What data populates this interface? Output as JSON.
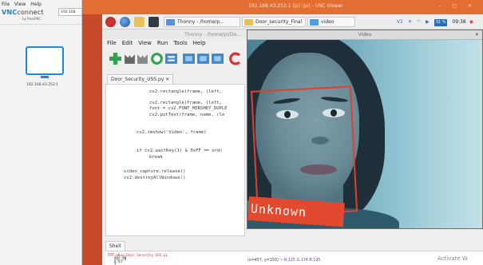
{
  "vnc_app": {
    "menu": [
      "File",
      "View",
      "Help"
    ],
    "logo_bold": "VNC",
    "logo_light": "connect",
    "logo_sub": "by RealVNC",
    "address_value": "192.168",
    "host_label": "192.168.43.252:1"
  },
  "viewer": {
    "title": "192.168.43.252:1 (pi) (pi) - VNC Viewer",
    "window_buttons": "– □ ✕"
  },
  "taskbar": {
    "apps": [
      {
        "label": "Thonny - /home/p..."
      },
      {
        "label": "Door_security_Final"
      },
      {
        "label": "video"
      }
    ],
    "battery": "31 %",
    "clock": "09:38"
  },
  "thonny": {
    "title": "Thonny - /home/pi/Do...",
    "menu": [
      "File",
      "Edit",
      "View",
      "Run",
      "Tools",
      "Help"
    ],
    "editor_tab": "Door_Security_USS.py ✕",
    "code_lines": [
      {
        "text": "cv2.rectangle(frame, (left, ",
        "indent": 2
      },
      {
        "text": "cv2.rectangle(frame, (left, ",
        "indent": 2
      },
      {
        "text": "font = cv2.FONT_HERSHEY_DUPLE",
        "indent": 2
      },
      {
        "text": "cv2.putText(frame, name, (le",
        "indent": 2
      },
      {
        "text": "cv2.imshow('Video', frame)",
        "indent": 1
      },
      {
        "text": "if cv2.waitKey(1) & 0xFF == ord(",
        "indent": 1
      },
      {
        "text": "break",
        "indent": 2
      },
      {
        "text": "video_capture.release()",
        "indent": 0
      },
      {
        "text": "cv2.destroyAllWindows()",
        "indent": 0
      }
    ],
    "shell_tab": "Shell",
    "shell_lines": [
      ">>>",
      ">>> %Run Door_Security_USS.py",
      "   347.00",
      "   285.20",
      "   4.84",
      "   1",
      "   2"
    ]
  },
  "video_window": {
    "title": "Video",
    "close": "✕",
    "detection_label": "Unknown",
    "status_prefix": "(x=457, y=150) ~ ",
    "status_values": "R:125 G:174 B:195"
  },
  "watermark": "Activate W",
  "colors": {
    "vnc_titlebar": "#e26e32",
    "detect_red": "#e0402a",
    "desktop_red": "#c44a2a",
    "vnc_blue": "#1b7dd0"
  }
}
